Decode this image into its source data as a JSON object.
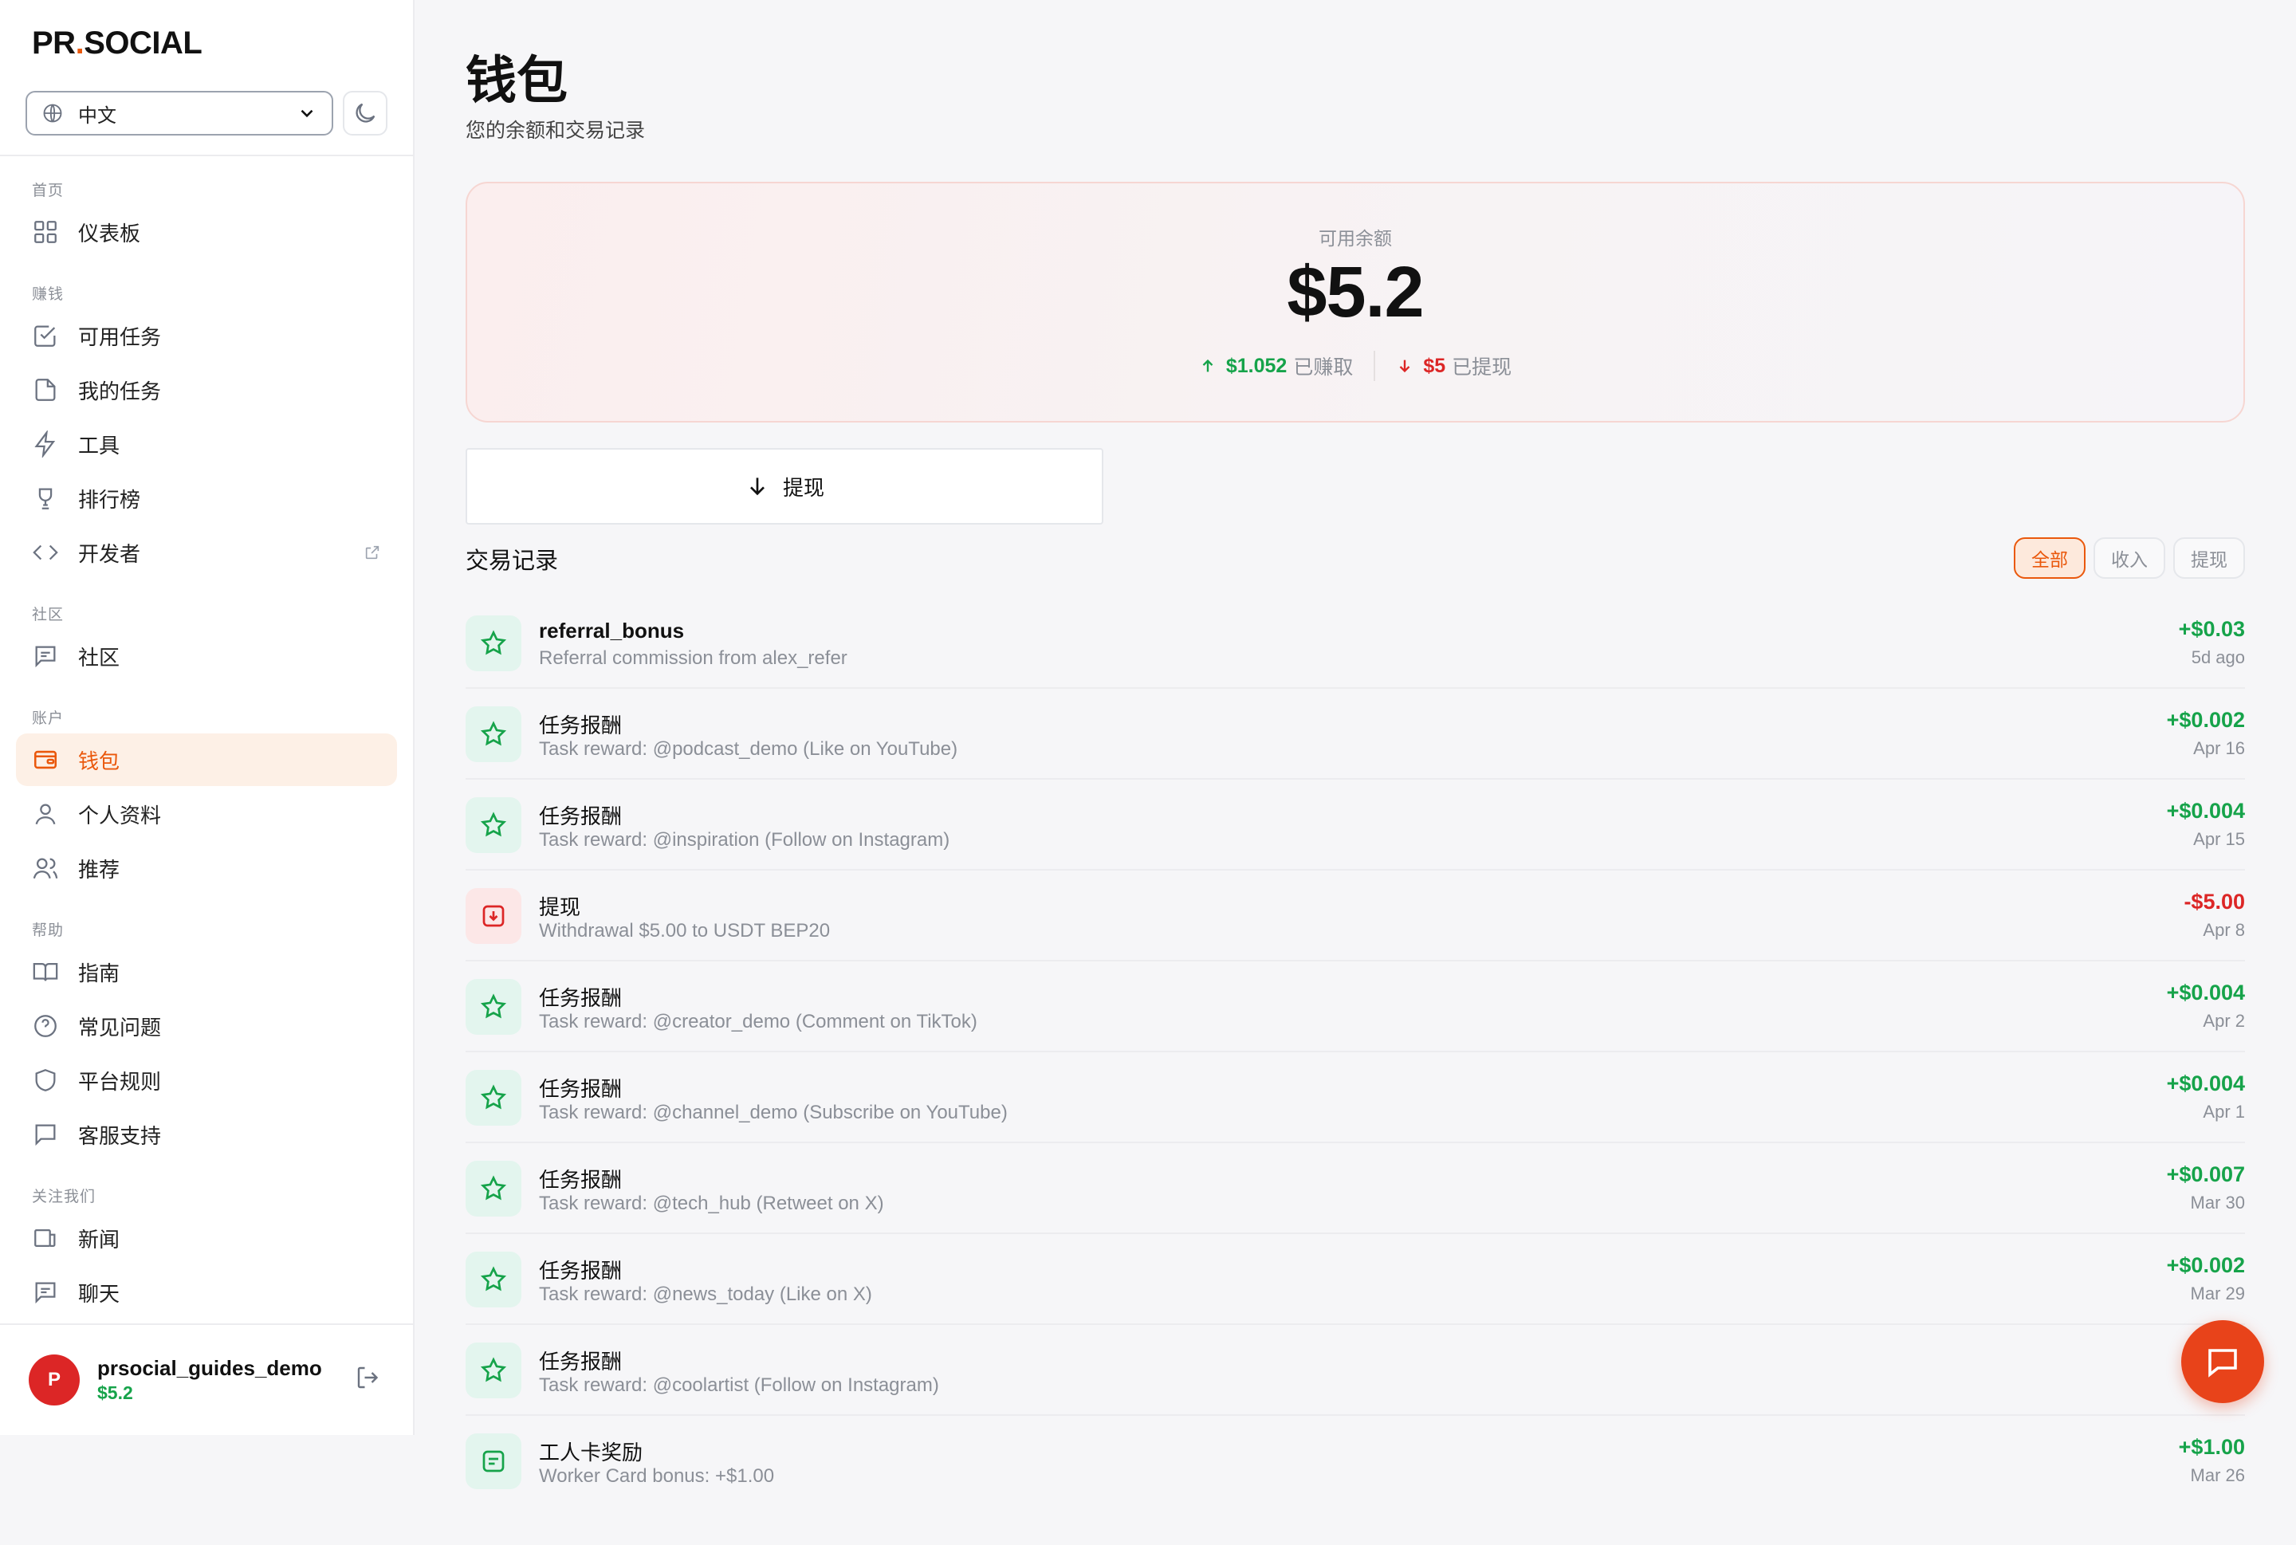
{
  "brand": {
    "part1": "PR",
    "dot": ".",
    "part2": "SOCIAL"
  },
  "lang": {
    "selected": "中文"
  },
  "sidebar": {
    "sections": [
      {
        "label": "首页",
        "items": [
          {
            "label": "仪表板",
            "icon": "grid-icon"
          }
        ]
      },
      {
        "label": "赚钱",
        "items": [
          {
            "label": "可用任务",
            "icon": "check-square-icon"
          },
          {
            "label": "我的任务",
            "icon": "file-icon"
          },
          {
            "label": "工具",
            "icon": "bolt-icon"
          },
          {
            "label": "排行榜",
            "icon": "trophy-icon"
          },
          {
            "label": "开发者",
            "icon": "code-icon"
          }
        ]
      },
      {
        "label": "社区",
        "items": [
          {
            "label": "社区",
            "icon": "message-square-icon"
          }
        ]
      },
      {
        "label": "账户",
        "items": [
          {
            "label": "钱包",
            "icon": "wallet-icon"
          },
          {
            "label": "个人资料",
            "icon": "user-icon"
          },
          {
            "label": "推荐",
            "icon": "users-icon"
          }
        ]
      },
      {
        "label": "帮助",
        "items": [
          {
            "label": "指南",
            "icon": "book-icon"
          },
          {
            "label": "常见问题",
            "icon": "help-circle-icon"
          },
          {
            "label": "平台规则",
            "icon": "shield-icon"
          },
          {
            "label": "客服支持",
            "icon": "message-icon"
          }
        ]
      },
      {
        "label": "关注我们",
        "items": [
          {
            "label": "新闻",
            "icon": "news-icon"
          },
          {
            "label": "聊天",
            "icon": "chat-icon"
          }
        ]
      }
    ]
  },
  "user": {
    "initial": "P",
    "name": "prsocial_guides_demo",
    "balance": "$5.2"
  },
  "page": {
    "title": "钱包",
    "subtitle": "您的余额和交易记录"
  },
  "balance": {
    "label": "可用余额",
    "amount": "$5.2",
    "earned_value": "$1.052",
    "earned_text": "已赚取",
    "withdrawn_value": "$5",
    "withdrawn_text": "已提现"
  },
  "withdraw_button": "提现",
  "transactions": {
    "title": "交易记录",
    "filters": [
      "全部",
      "收入",
      "提现"
    ],
    "items": [
      {
        "title": "referral_bonus",
        "desc": "Referral commission from alex_refer",
        "amount": "+$0.03",
        "date": "5d ago",
        "type": "in",
        "icon": "star-icon"
      },
      {
        "title": "任务报酬",
        "desc": "Task reward: @podcast_demo (Like on YouTube)",
        "amount": "+$0.002",
        "date": "Apr 16",
        "type": "in",
        "icon": "star-icon"
      },
      {
        "title": "任务报酬",
        "desc": "Task reward: @inspiration (Follow on Instagram)",
        "amount": "+$0.004",
        "date": "Apr 15",
        "type": "in",
        "icon": "star-icon"
      },
      {
        "title": "提现",
        "desc": "Withdrawal $5.00 to USDT BEP20",
        "amount": "-$5.00",
        "date": "Apr 8",
        "type": "out",
        "icon": "download-box-icon"
      },
      {
        "title": "任务报酬",
        "desc": "Task reward: @creator_demo (Comment on TikTok)",
        "amount": "+$0.004",
        "date": "Apr 2",
        "type": "in",
        "icon": "star-icon"
      },
      {
        "title": "任务报酬",
        "desc": "Task reward: @channel_demo (Subscribe on YouTube)",
        "amount": "+$0.004",
        "date": "Apr 1",
        "type": "in",
        "icon": "star-icon"
      },
      {
        "title": "任务报酬",
        "desc": "Task reward: @tech_hub (Retweet on X)",
        "amount": "+$0.007",
        "date": "Mar 30",
        "type": "in",
        "icon": "star-icon"
      },
      {
        "title": "任务报酬",
        "desc": "Task reward: @news_today (Like on X)",
        "amount": "+$0.002",
        "date": "Mar 29",
        "type": "in",
        "icon": "star-icon"
      },
      {
        "title": "任务报酬",
        "desc": "Task reward: @coolartist (Follow on Instagram)",
        "amount": "+$",
        "date": "",
        "type": "in",
        "icon": "star-icon"
      },
      {
        "title": "工人卡奖励",
        "desc": "Worker Card bonus: +$1.00",
        "amount": "+$1.00",
        "date": "Mar 26",
        "type": "in",
        "icon": "card-icon"
      }
    ]
  },
  "colors": {
    "accent": "#ea580c",
    "positive": "#16a34a",
    "negative": "#dc2626",
    "fab": "#e8431a"
  }
}
